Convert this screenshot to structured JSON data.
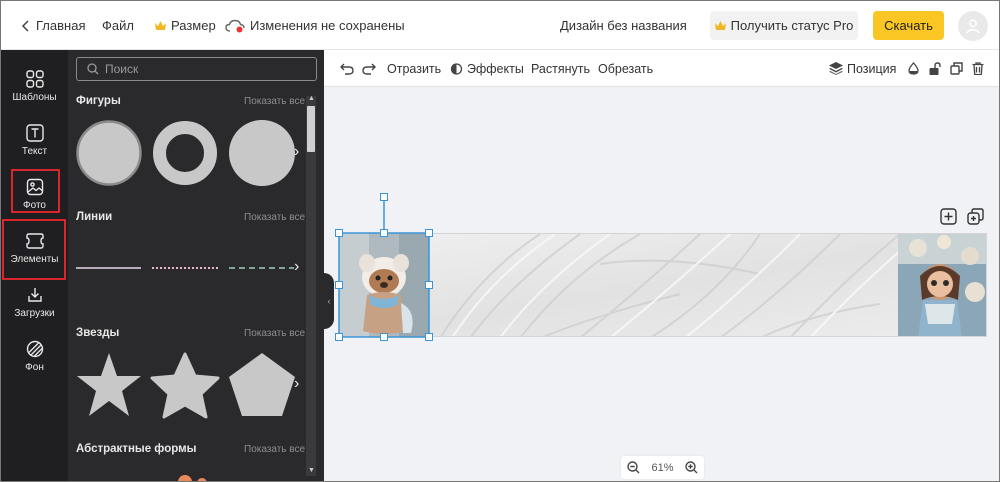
{
  "topbar": {
    "home": "Главная",
    "file": "Файл",
    "size": "Размер",
    "unsaved": "Изменения не сохранены",
    "design_name": "Дизайн без названия",
    "pro": "Получить статус Pro",
    "download": "Скачать"
  },
  "rail": {
    "templates": "Шаблоны",
    "text": "Текст",
    "photo": "Фото",
    "elements": "Элементы",
    "uploads": "Загрузки",
    "background": "Фон"
  },
  "panel": {
    "search_placeholder": "Поиск",
    "show_all": "Показать все",
    "sections": [
      "Фигуры",
      "Линии",
      "Звезды",
      "Абстрактные формы"
    ]
  },
  "toolbar": {
    "flip": "Отразить",
    "effects": "Эффекты",
    "stretch": "Растянуть",
    "crop": "Обрезать",
    "position": "Позиция"
  },
  "zoom": {
    "level": "61%"
  },
  "colors": {
    "accent": "#f9c623",
    "selection": "#3a95d8",
    "highlight": "#d9262c",
    "panel": "#2a2a2d"
  }
}
